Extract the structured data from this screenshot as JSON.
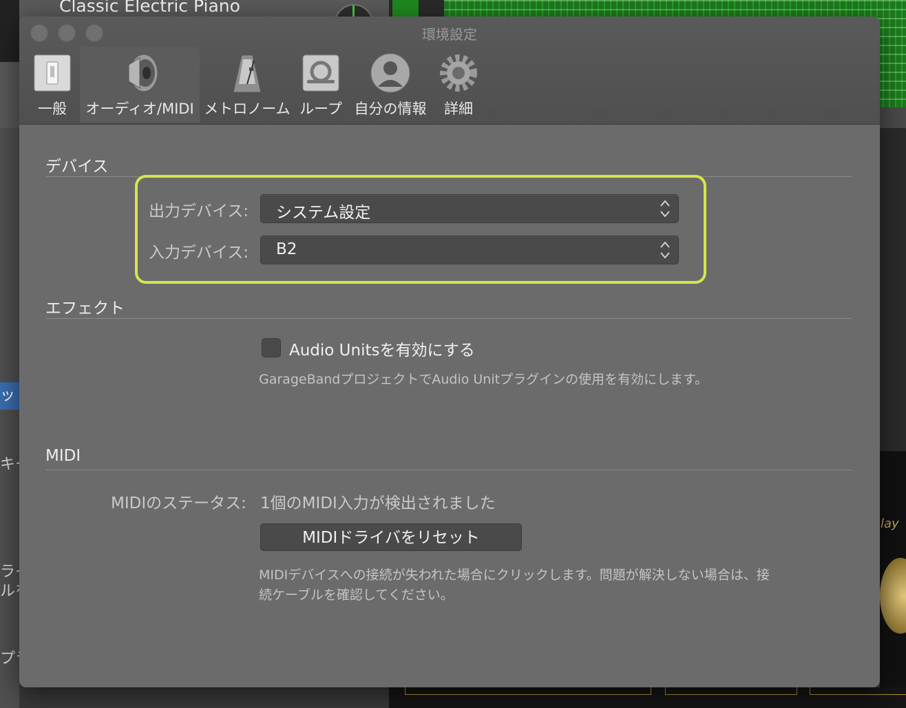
{
  "background_app": {
    "track_name": "Classic Electric Piano",
    "left_tab_text": "ッ",
    "left_text_1": "キー",
    "left_text_2": "ライ",
    "left_text_3": "ルを",
    "left_text_4": "プラ",
    "amp_text": "lay"
  },
  "window": {
    "title": "環境設定",
    "tabs": [
      {
        "label": "一般",
        "icon": "switch-icon"
      },
      {
        "label": "オーディオ/MIDI",
        "icon": "speaker-icon",
        "selected": true
      },
      {
        "label": "メトロノーム",
        "icon": "metronome-icon"
      },
      {
        "label": "ループ",
        "icon": "loop-icon"
      },
      {
        "label": "自分の情報",
        "icon": "user-icon"
      },
      {
        "label": "詳細",
        "icon": "gear-icon"
      }
    ]
  },
  "devices": {
    "section_title": "デバイス",
    "output_label": "出力デバイス:",
    "output_value": "システム設定",
    "input_label": "入力デバイス:",
    "input_value": "B2",
    "highlight_color": "#d6e64a"
  },
  "effects": {
    "section_title": "エフェクト",
    "checkbox_label": "Audio Unitsを有効にする",
    "checkbox_checked": false,
    "description": "GarageBandプロジェクトでAudio Unitプラグインの使用を有効にします。"
  },
  "midi": {
    "section_title": "MIDI",
    "status_label": "MIDIのステータス:",
    "status_value": "1個のMIDI入力が検出されました",
    "reset_button": "MIDIドライバをリセット",
    "description_line1": "MIDIデバイスへの接続が失われた場合にクリックします。問題が解決しない場合は、接",
    "description_line2": "続ケーブルを確認してください。"
  }
}
